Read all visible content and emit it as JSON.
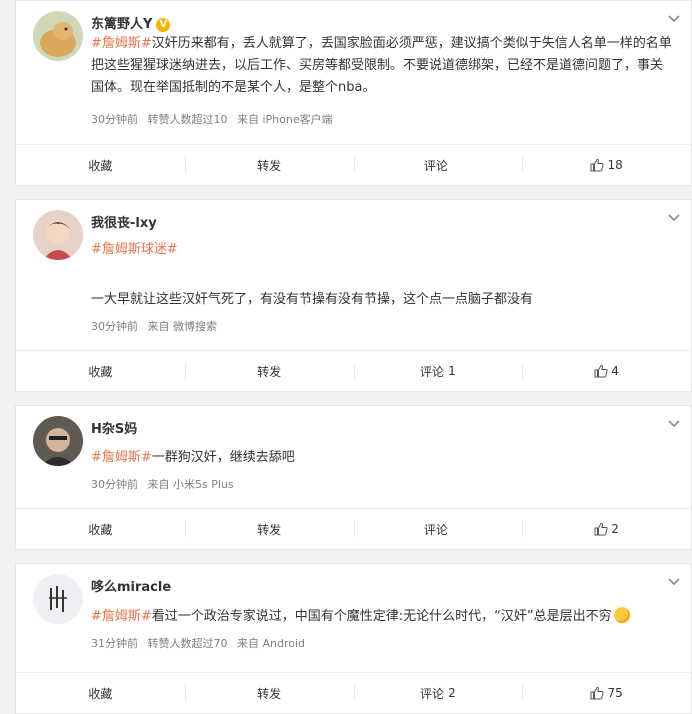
{
  "posts": [
    {
      "name": "东篱野人Y",
      "verified_badge": "V",
      "content": {
        "topic": "#詹姆斯#",
        "text": "汉奸历来都有，丢人就算了，丢国家脸面必须严惩，建议搞个类似于失信人名单一样的名单把这些猩猩球迷纳进去，以后工作、买房等都受限制。不要说道德绑架，已经不是道德问题了，事关国体。现在举国抵制的不是某个人，是整个nba。"
      },
      "meta": {
        "time": "30分钟前",
        "repost": "转赞人数超过10",
        "source": "来自 iPhone客户端"
      },
      "actions": {
        "fav": "收藏",
        "repost": "转发",
        "comment": "评论",
        "comment_count": "",
        "like_count": "18"
      }
    },
    {
      "name": "我很丧-lxy",
      "content": {
        "topic": "#詹姆斯球迷#",
        "text": "一大早就让这些汉奸气死了，有没有节操有没有节操，这个点一点脑子都没有"
      },
      "meta": {
        "time": "30分钟前",
        "repost": "",
        "source": "来自 微博搜索"
      },
      "actions": {
        "fav": "收藏",
        "repost": "转发",
        "comment": "评论",
        "comment_count": "1",
        "like_count": "4"
      }
    },
    {
      "name": "H杂S妈",
      "content": {
        "topic": "#詹姆斯#",
        "text": "一群狗汉奸，继续去舔吧"
      },
      "meta": {
        "time": "30分钟前",
        "repost": "",
        "source": "来自 小米5s Plus"
      },
      "actions": {
        "fav": "收藏",
        "repost": "转发",
        "comment": "评论",
        "comment_count": "",
        "like_count": "2"
      }
    },
    {
      "name": "哆么miracle",
      "content": {
        "topic": "#詹姆斯#",
        "text": "看过一个政治专家说过，中国有个魔性定律:无论什么时代，“汉奸”总是层出不穷"
      },
      "meta": {
        "time": "31分钟前",
        "repost": "转赞人数超过70",
        "source": "来自 Android"
      },
      "actions": {
        "fav": "收藏",
        "repost": "转发",
        "comment": "评论",
        "comment_count": "2",
        "like_count": "75"
      }
    }
  ],
  "colors": {
    "topic": "#eb7350",
    "badge": "#f7b500",
    "meta": "#808080"
  }
}
